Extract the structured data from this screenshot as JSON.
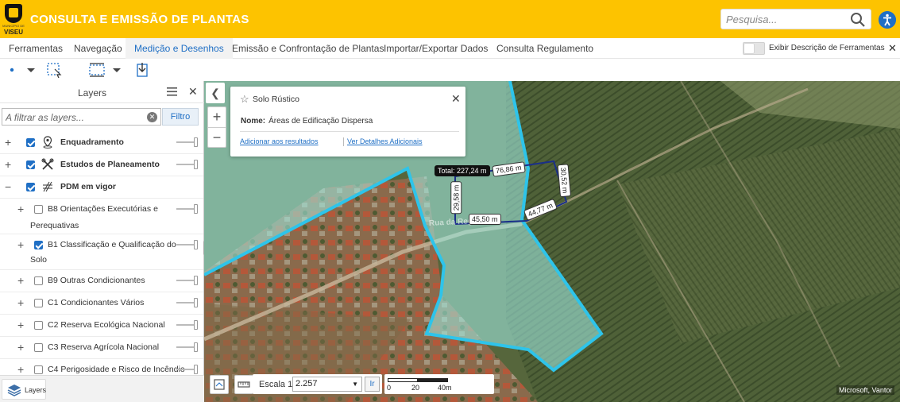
{
  "header": {
    "app_title": "CONSULTA E EMISSÃO DE PLANTAS",
    "logo_text": "VISEU",
    "logo_small": "MUNICÍPIO DE",
    "search_placeholder": "Pesquisa...",
    "accent_color": "#fdc300",
    "icons": [
      "search-icon",
      "accessibility-icon"
    ]
  },
  "tabs": [
    {
      "label": "Ferramentas",
      "active": false
    },
    {
      "label": "Navegação",
      "active": false
    },
    {
      "label": "Medição e Desenhos",
      "active": true
    },
    {
      "label": "Emissão e Confrontação de Plantas",
      "active": false
    },
    {
      "label": "Importar/Exportar Dados",
      "active": false
    },
    {
      "label": "Consulta Regulamento",
      "active": false
    }
  ],
  "toggle": {
    "label": "Exibir Descrição de Ferramentas",
    "on": false
  },
  "toolbar": {
    "tools": [
      "draw-point-icon",
      "dropdown-icon",
      "select-area-icon",
      "measure-area-icon",
      "dropdown-icon",
      "import-icon"
    ]
  },
  "layers": {
    "title": "Layers",
    "filter_placeholder": "A filtrar as layers...",
    "filter_button": "Filtro",
    "items": [
      {
        "label": "Enquadramento",
        "checked": true,
        "bold": true,
        "icon": "location-pin-icon",
        "expand": "+"
      },
      {
        "label": "Estudos de Planeamento",
        "checked": true,
        "bold": true,
        "icon": "tools-icon",
        "expand": "+"
      },
      {
        "label": "PDM em vigor",
        "checked": true,
        "bold": true,
        "icon": "hatch-icon",
        "expand": "−"
      },
      {
        "label_line1": "B8 Orientações Executórias e",
        "label_line2": "Perequativas",
        "checked": false,
        "expand": "+"
      },
      {
        "label_line1": "B1 Classificação e Qualificação do",
        "label_line2": "Solo",
        "checked": true,
        "expand": "+"
      },
      {
        "label": "B9 Outras Condicionantes",
        "checked": false,
        "expand": "+"
      },
      {
        "label": "C1 Condicionantes Vários",
        "checked": false,
        "expand": "+"
      },
      {
        "label": "C2 Reserva Ecológica Nacional",
        "checked": false,
        "expand": "+"
      },
      {
        "label": "C3 Reserva Agrícola Nacional",
        "checked": false,
        "expand": "+"
      },
      {
        "label": "C4 Perigosidade e Risco de Incêndio",
        "checked": false,
        "expand": "+"
      }
    ],
    "footer_tab": "Layers"
  },
  "popup": {
    "title": "Solo Rústico",
    "field_name": "Nome:",
    "field_value": "Áreas de Edificação Dispersa",
    "link_add": "Adicionar aos resultados",
    "link_details": "Ver Detalhes Adicionais"
  },
  "measurements": {
    "total": "Total: 227,24 m",
    "segments": [
      "76,86 m",
      "30,52 m",
      "44,77 m",
      "45,50 m",
      "29,58 m"
    ],
    "line_color": "#1a2f8a"
  },
  "map": {
    "road_name": "Rua da Regueira",
    "scale_label": "Escala 1:",
    "scale_value": "2.257",
    "go_button": "Ir",
    "scalebar_ticks": [
      "0",
      "20",
      "40m"
    ],
    "attribution": "Microsoft, Vantor",
    "zone_color": "#9fe6dc",
    "zone_border": "#2ec4ea"
  }
}
